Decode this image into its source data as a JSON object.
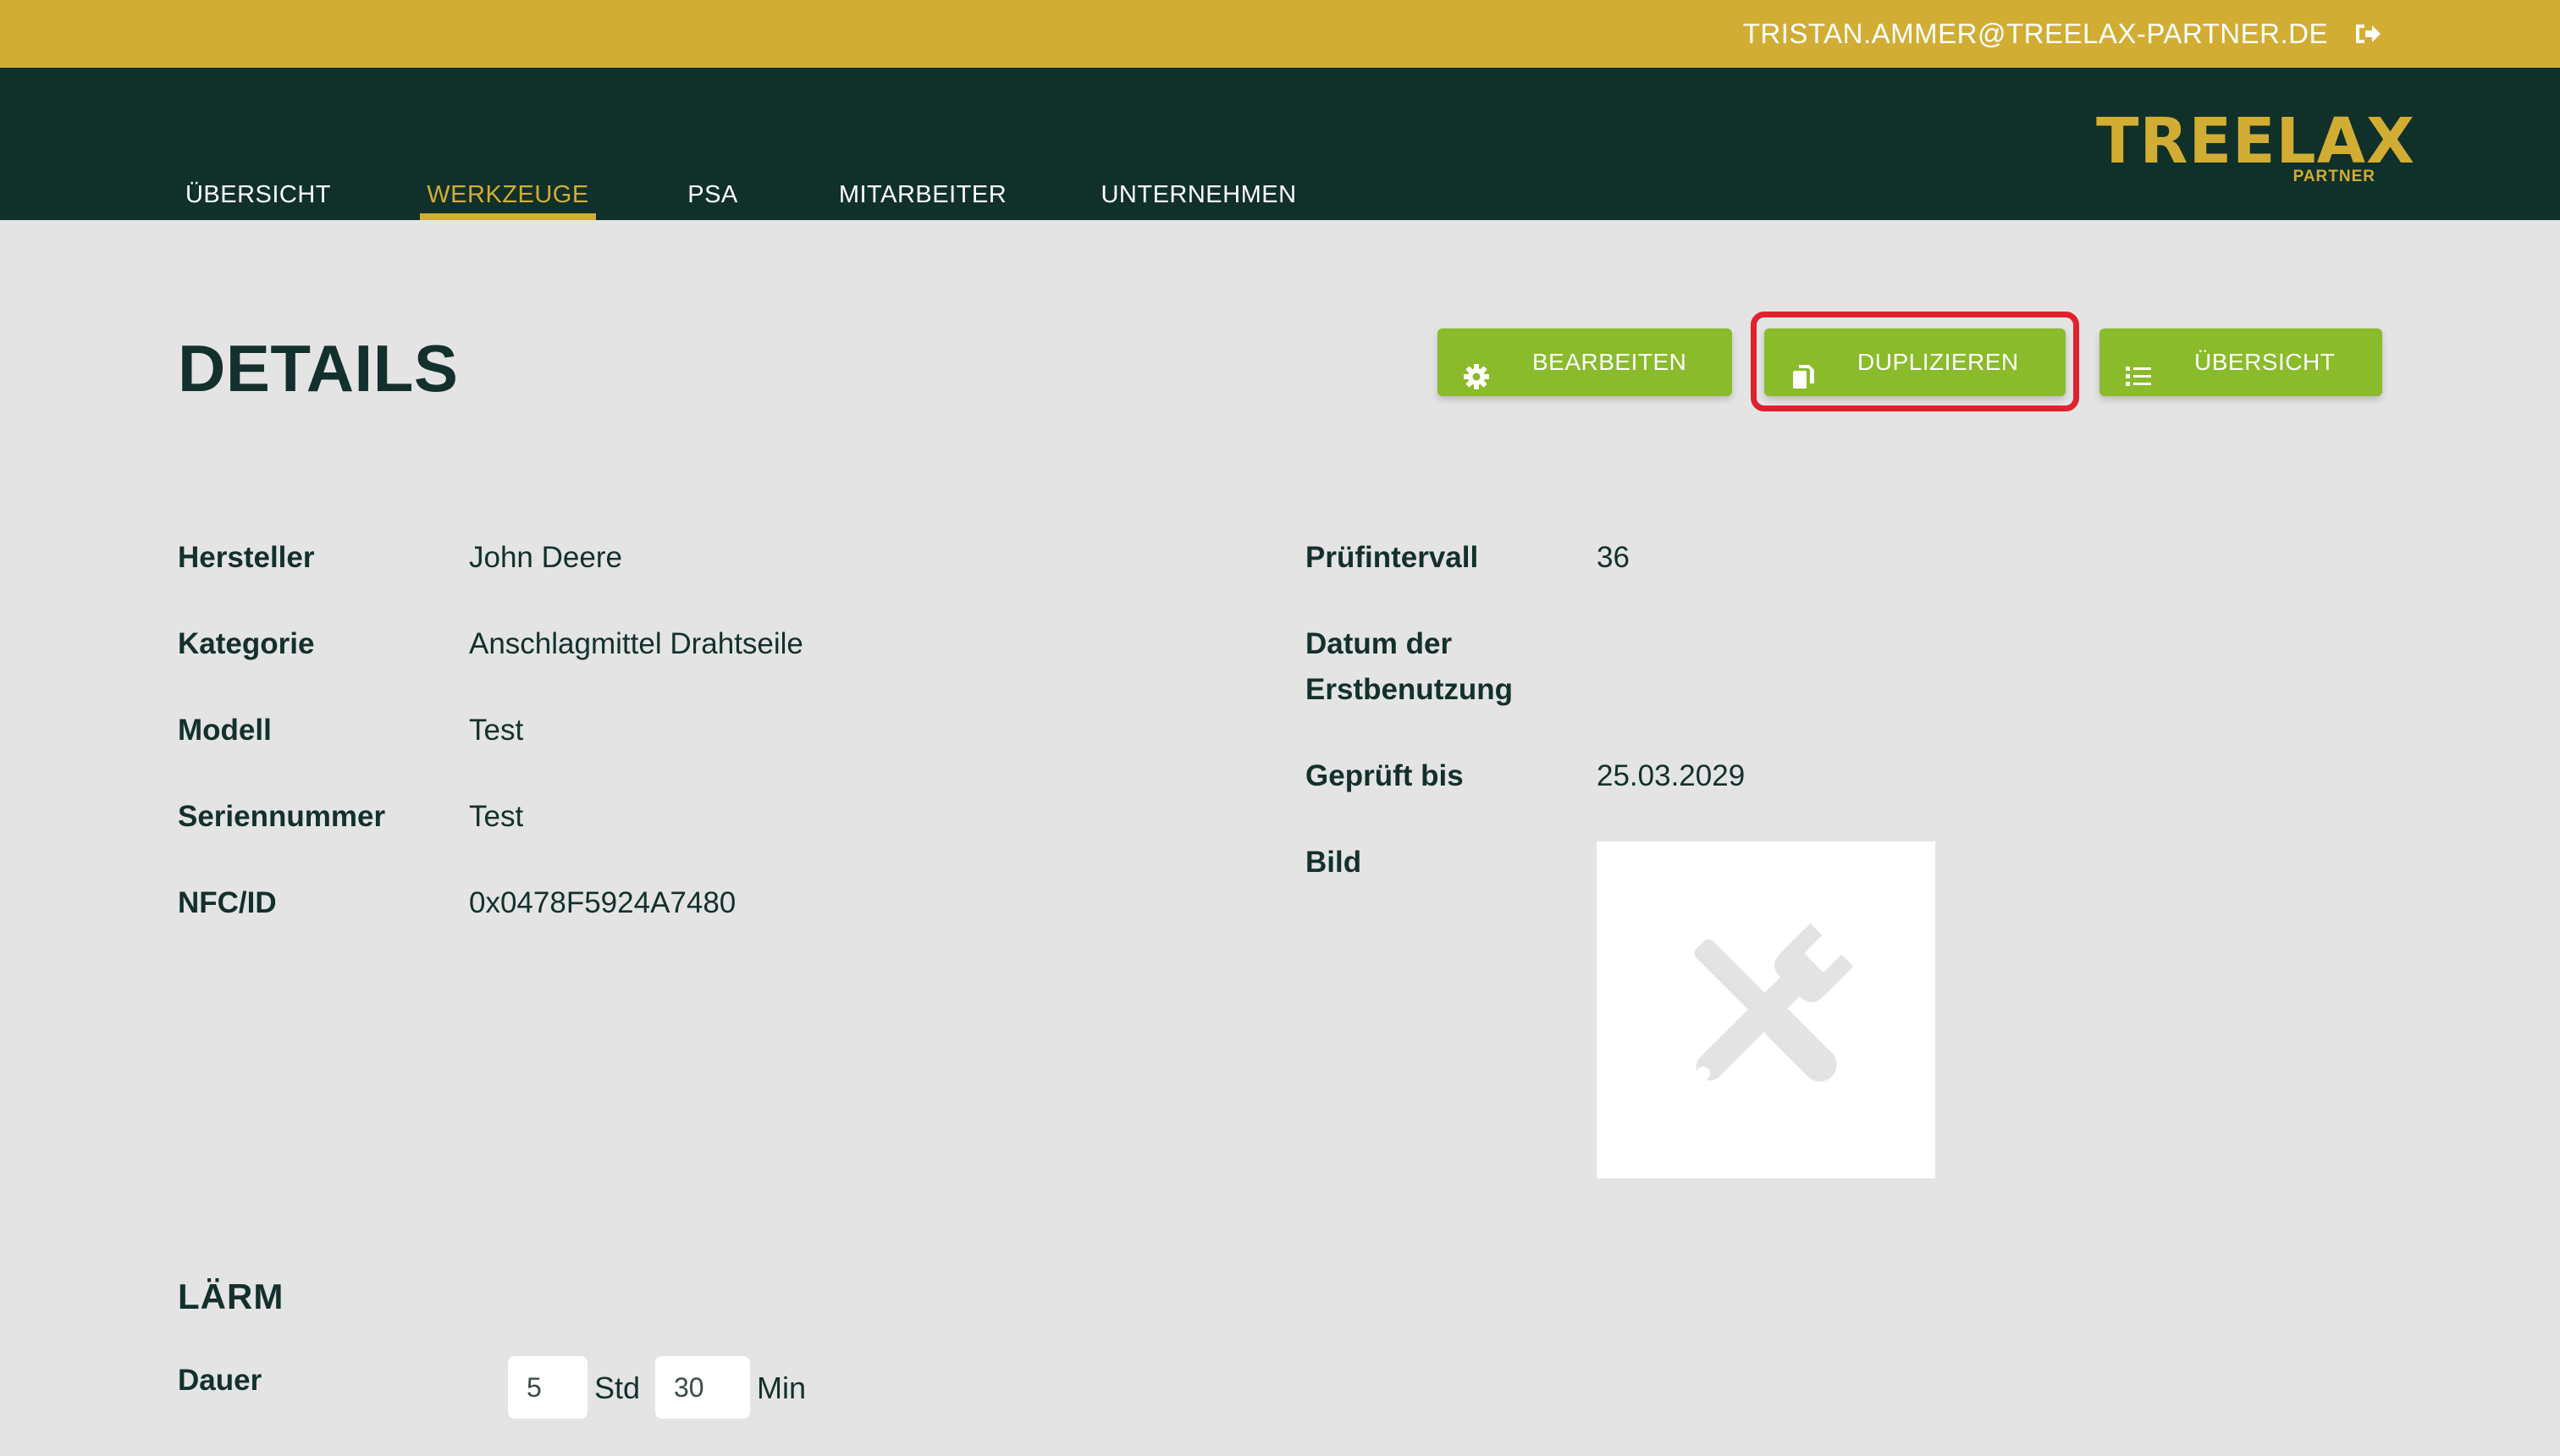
{
  "userbar": {
    "email": "TRISTAN.AMMER@TREELAX-PARTNER.DE",
    "logout_icon": "sign-out-icon"
  },
  "nav": {
    "tabs": [
      {
        "label": "ÜBERSICHT",
        "active": false
      },
      {
        "label": "WERKZEUGE",
        "active": true
      },
      {
        "label": "PSA",
        "active": false
      },
      {
        "label": "MITARBEITER",
        "active": false
      },
      {
        "label": "UNTERNEHMEN",
        "active": false
      }
    ],
    "logo": {
      "word": "TREELAX",
      "sub": "PARTNER"
    }
  },
  "page": {
    "title": "DETAILS"
  },
  "actions": {
    "edit": {
      "label": "BEARBEITEN",
      "icon": "gear-icon"
    },
    "duplicate": {
      "label": "DUPLIZIEREN",
      "icon": "copy-icon"
    },
    "overview": {
      "label": "ÜBERSICHT",
      "icon": "list-icon"
    }
  },
  "details_left": [
    {
      "label": "Hersteller",
      "value": "John Deere"
    },
    {
      "label": "Kategorie",
      "value": "Anschlagmittel Drahtseile"
    },
    {
      "label": "Modell",
      "value": "Test"
    },
    {
      "label": "Seriennummer",
      "value": "Test"
    },
    {
      "label": "NFC/ID",
      "value": "0x0478F5924A7480"
    }
  ],
  "details_right": {
    "pruefintervall": {
      "label": "Prüfintervall",
      "value": "36"
    },
    "erstbenutzung": {
      "label_line1": "Datum der",
      "label_line2": "Erstbenutzung",
      "value": ""
    },
    "geprueft_bis": {
      "label": "Geprüft bis",
      "value": "25.03.2029"
    },
    "bild": {
      "label": "Bild",
      "placeholder_icon": "tools-icon"
    }
  },
  "laerm": {
    "title": "LÄRM",
    "dauer_label": "Dauer",
    "hours_value": "5",
    "hours_unit": "Std",
    "minutes_value": "30",
    "minutes_unit": "Min"
  },
  "colors": {
    "gold": "#d2ad33",
    "dark_green": "#10302a",
    "button_green": "#8abb2a",
    "highlight_red": "#e0212e",
    "background": "#e4e4e4"
  }
}
